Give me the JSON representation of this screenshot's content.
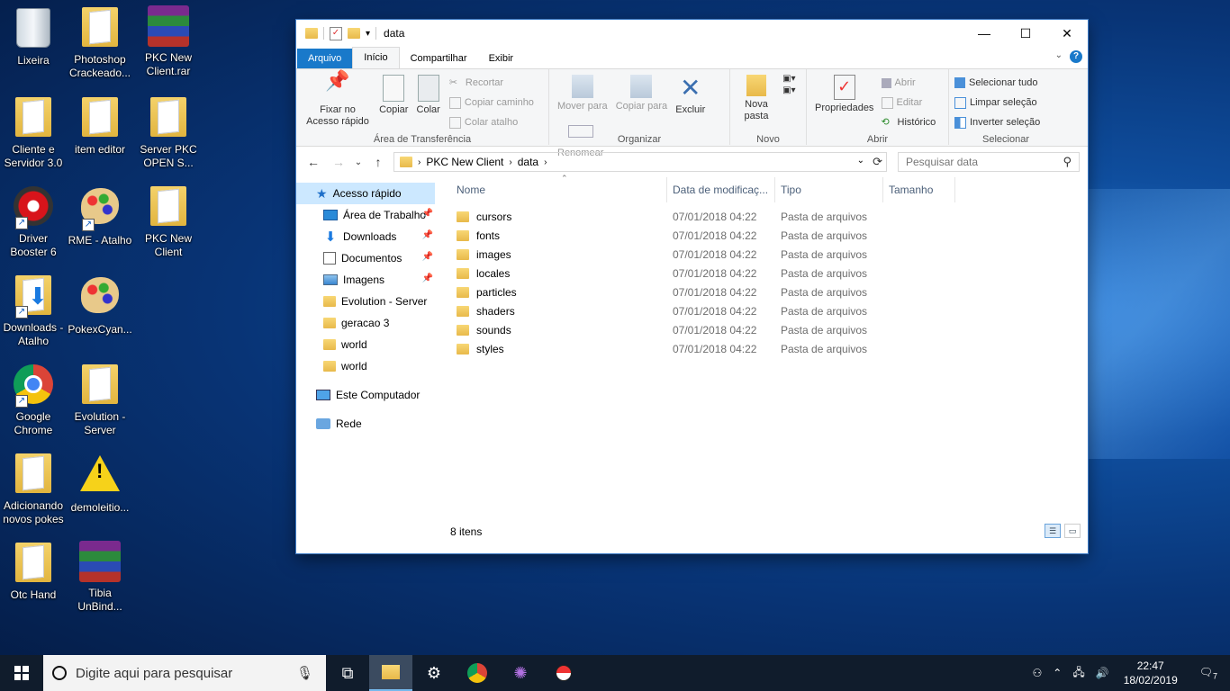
{
  "desktop": {
    "icons": [
      {
        "label": "Lixeira",
        "icon": "recycle-bin-icon"
      },
      {
        "label": "Photoshop Crackeado...",
        "icon": "folder-icon"
      },
      {
        "label": "PKC New Client.rar",
        "icon": "winrar-icon"
      },
      {
        "label": "Cliente e Servidor 3.0",
        "icon": "folder-icon"
      },
      {
        "label": "item editor",
        "icon": "folder-icon"
      },
      {
        "label": "Server PKC OPEN S...",
        "icon": "folder-icon"
      },
      {
        "label": "Driver Booster 6",
        "icon": "driver-booster-icon"
      },
      {
        "label": "RME - Atalho",
        "icon": "palette-icon"
      },
      {
        "label": "PKC New Client",
        "icon": "folder-icon"
      },
      {
        "label": "Downloads - Atalho",
        "icon": "downloads-folder-icon"
      },
      {
        "label": "PokexCyan...",
        "icon": "palette-icon"
      },
      {
        "label": "Google Chrome",
        "icon": "chrome-icon"
      },
      {
        "label": "Evolution - Server",
        "icon": "folder-icon"
      },
      {
        "label": "Adicionando novos pokes",
        "icon": "folder-icon"
      },
      {
        "label": "demoleitio...",
        "icon": "warning-icon"
      },
      {
        "label": "Otc Hand",
        "icon": "folder-icon"
      },
      {
        "label": "Tibia UnBind...",
        "icon": "winrar-icon"
      }
    ]
  },
  "window": {
    "title": "data",
    "tabs": {
      "file": "Arquivo",
      "home": "Início",
      "share": "Compartilhar",
      "view": "Exibir"
    },
    "ribbon": {
      "clipboard": {
        "label": "Área de Transferência",
        "pin": "Fixar no Acesso rápido",
        "copy": "Copiar",
        "paste": "Colar",
        "cut": "Recortar",
        "copy_path": "Copiar caminho",
        "paste_shortcut": "Colar atalho"
      },
      "organize": {
        "label": "Organizar",
        "move_to": "Mover para",
        "copy_to": "Copiar para",
        "delete": "Excluir",
        "rename": "Renomear"
      },
      "new": {
        "label": "Novo",
        "new_folder": "Nova pasta"
      },
      "open": {
        "label": "Abrir",
        "properties": "Propriedades",
        "open": "Abrir",
        "edit": "Editar",
        "history": "Histórico"
      },
      "select": {
        "label": "Selecionar",
        "select_all": "Selecionar tudo",
        "clear": "Limpar seleção",
        "invert": "Inverter seleção"
      }
    },
    "address": {
      "crumbs": [
        "PKC New Client",
        "data"
      ]
    },
    "search_placeholder": "Pesquisar data",
    "nav_pane": {
      "quick_access": "Acesso rápido",
      "pinned": [
        "Área de Trabalho",
        "Downloads",
        "Documentos",
        "Imagens"
      ],
      "recent": [
        "Evolution - Server",
        "geracao 3",
        "world",
        "world"
      ],
      "this_pc": "Este Computador",
      "network": "Rede"
    },
    "columns": {
      "name": "Nome",
      "date": "Data de modificaç...",
      "type": "Tipo",
      "size": "Tamanho"
    },
    "files": [
      {
        "name": "cursors",
        "date": "07/01/2018 04:22",
        "type": "Pasta de arquivos"
      },
      {
        "name": "fonts",
        "date": "07/01/2018 04:22",
        "type": "Pasta de arquivos"
      },
      {
        "name": "images",
        "date": "07/01/2018 04:22",
        "type": "Pasta de arquivos"
      },
      {
        "name": "locales",
        "date": "07/01/2018 04:22",
        "type": "Pasta de arquivos"
      },
      {
        "name": "particles",
        "date": "07/01/2018 04:22",
        "type": "Pasta de arquivos"
      },
      {
        "name": "shaders",
        "date": "07/01/2018 04:22",
        "type": "Pasta de arquivos"
      },
      {
        "name": "sounds",
        "date": "07/01/2018 04:22",
        "type": "Pasta de arquivos"
      },
      {
        "name": "styles",
        "date": "07/01/2018 04:22",
        "type": "Pasta de arquivos"
      }
    ],
    "status": "8 itens"
  },
  "taskbar": {
    "search_placeholder": "Digite aqui para pesquisar",
    "time": "22:47",
    "date": "18/02/2019",
    "notifications": "7"
  },
  "colors": {
    "accent": "#1979ca",
    "selection": "#cce8ff",
    "taskbar": "#101c2c"
  }
}
